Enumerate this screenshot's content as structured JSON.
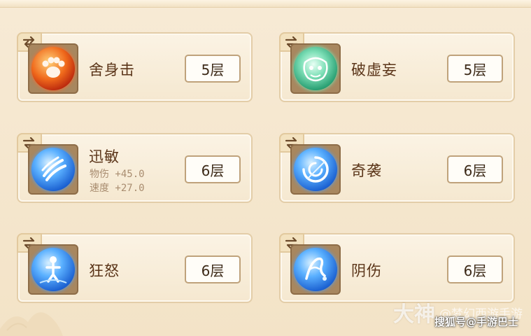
{
  "skills": [
    {
      "name": "舍身击",
      "level": "5层",
      "icon": "red-claw-orb-icon",
      "color": "#d23a12",
      "stats": []
    },
    {
      "name": "破虚妄",
      "level": "5层",
      "icon": "green-beast-orb-icon",
      "color": "#2aa37a",
      "stats": []
    },
    {
      "name": "迅敏",
      "level": "6层",
      "icon": "blue-claw-orb-icon",
      "color": "#1e6fd9",
      "stats": [
        "物伤 +45.0",
        "速度 +27.0"
      ]
    },
    {
      "name": "奇袭",
      "level": "6层",
      "icon": "blue-swirl-orb-icon",
      "color": "#1e6fd9",
      "stats": []
    },
    {
      "name": "狂怒",
      "level": "6层",
      "icon": "blue-figure-orb-icon",
      "color": "#1e6fd9",
      "stats": []
    },
    {
      "name": "阴伤",
      "level": "6层",
      "icon": "blue-hand-orb-icon",
      "color": "#1e6fd9",
      "stats": []
    }
  ],
  "watermark": {
    "logo": "大神",
    "handle": "@梦幻西游手游",
    "credit": "搜狐号@手游巴士"
  }
}
